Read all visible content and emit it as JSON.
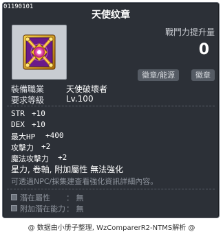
{
  "item": {
    "id": "01190101",
    "name": "天使纹章"
  },
  "power": {
    "label": "戰鬥力提升量",
    "value": "0"
  },
  "tags": {
    "source": "徽章/能源",
    "emblem": "徽章"
  },
  "info": {
    "job_label": "裝備職業",
    "job_value": "天使破壞者",
    "level_label": "要求等級",
    "level_value": "Lv.100"
  },
  "stats": [
    {
      "label": "STR",
      "value": "+10"
    },
    {
      "label": "DEX",
      "value": "+10"
    },
    {
      "label": "最大HP",
      "value": "+400"
    },
    {
      "label": "攻擊力",
      "value": "+2"
    },
    {
      "label": "魔法攻擊力",
      "value": "+2"
    }
  ],
  "properties": "星力, 卷軸, 附加屬性  無法強化",
  "hint": "可透過NPC/採集建查看強化資訊詳細內容。",
  "potential": {
    "potential_label": "潛在屬性",
    "potential_value": "： 無",
    "bonus_label": "附加潛在能力",
    "bonus_value": "： 無"
  },
  "footer": "@ 数据由小册子整理, WzComparerR2-NTMS解析 @",
  "colors": {
    "panel_bg": "#2c3037",
    "panel_border": "#6a7079",
    "icon_box_bg": "#c8ccd2",
    "gem": "#ff3aa8",
    "gold": "#d4a21a",
    "purple": "#7a1f9a"
  }
}
